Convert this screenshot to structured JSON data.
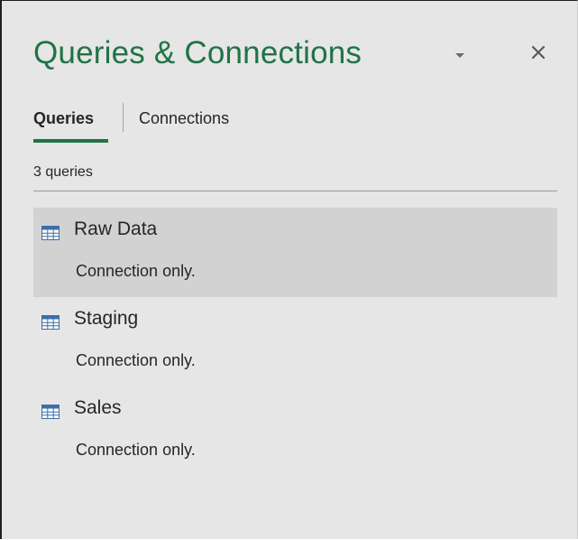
{
  "pane": {
    "title": "Queries & Connections",
    "accent_color": "#217346"
  },
  "controls": {
    "dropdown_icon": "chevron-down-icon",
    "close_icon": "close-icon",
    "close_glyph": "✕"
  },
  "tabs": [
    {
      "label": "Queries",
      "active": true
    },
    {
      "label": "Connections",
      "active": false
    }
  ],
  "query_count": "3 queries",
  "queries": [
    {
      "name": "Raw Data",
      "status": "Connection only.",
      "icon": "table-icon",
      "selected": true
    },
    {
      "name": "Staging",
      "status": "Connection only.",
      "icon": "table-icon",
      "selected": false
    },
    {
      "name": "Sales",
      "status": "Connection only.",
      "icon": "table-icon",
      "selected": false
    }
  ]
}
